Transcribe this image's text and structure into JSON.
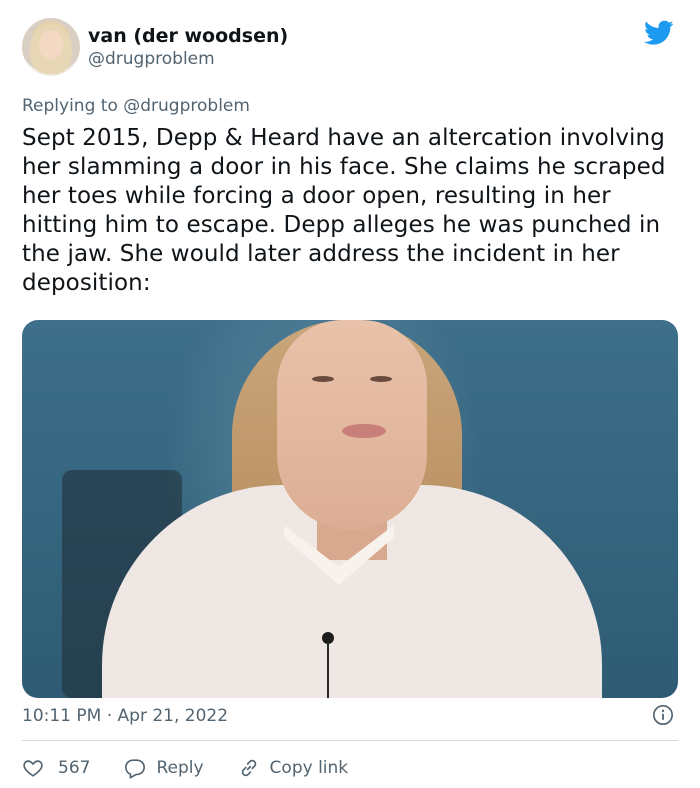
{
  "author": {
    "display_name": "van (der woodsen)",
    "handle": "@drugproblem"
  },
  "reply": {
    "prefix": "Replying to",
    "mention": "@drugproblem"
  },
  "tweet": {
    "text": "Sept 2015, Depp & Heard have an altercation involving her slamming a door in his face. She claims he scraped her toes while forcing a door open, resulting in her hitting him to escape. Depp alleges he was punched in the jaw. She would later address the incident in her deposition:",
    "timestamp": "10:11 PM · Apr 21, 2022"
  },
  "actions": {
    "like_count": "567",
    "reply_label": "Reply",
    "copy_link_label": "Copy link"
  },
  "colors": {
    "twitter_blue": "#1d9bf0",
    "secondary_text": "#536471",
    "primary_text": "#0f1419",
    "divider": "#cfd9de"
  },
  "icons": {
    "logo": "twitter-bird-icon",
    "info": "info-icon",
    "like": "heart-icon",
    "reply": "speech-bubble-icon",
    "copy_link": "link-icon"
  }
}
